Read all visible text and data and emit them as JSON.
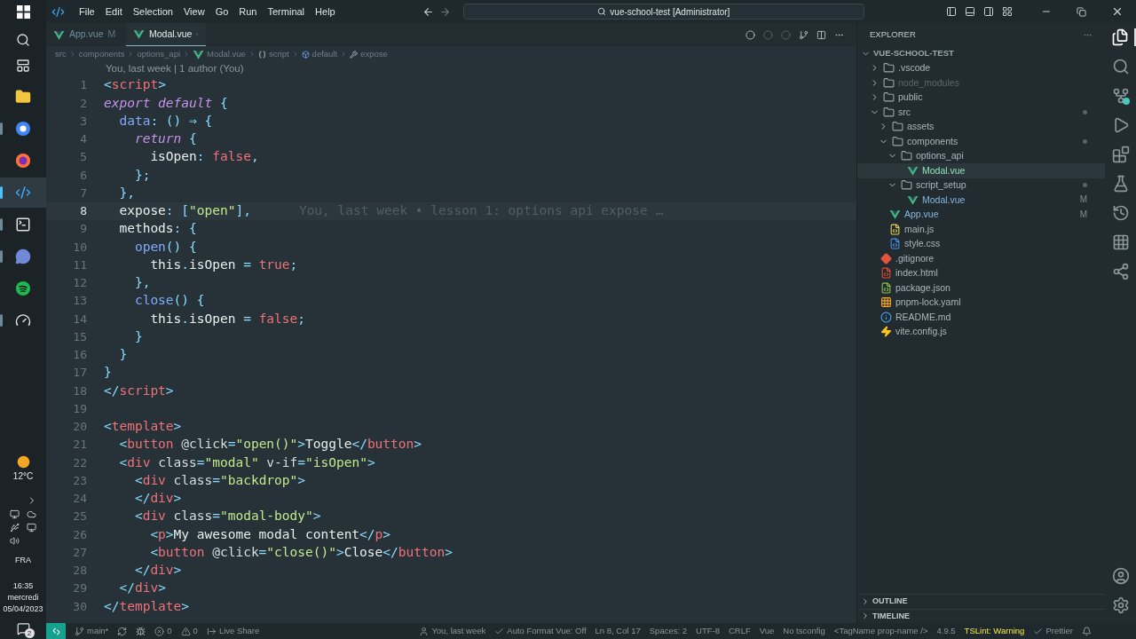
{
  "taskbar": {
    "apps": [
      {
        "kind": "explorer",
        "running": false,
        "selected": false
      },
      {
        "kind": "chrome",
        "running": true,
        "selected": false
      },
      {
        "kind": "firefox",
        "running": false,
        "selected": false
      },
      {
        "kind": "vscode",
        "running": true,
        "selected": true
      },
      {
        "kind": "terminal",
        "running": true,
        "selected": false
      },
      {
        "kind": "discord",
        "running": true,
        "selected": false
      },
      {
        "kind": "spotify",
        "running": false,
        "selected": false
      },
      {
        "kind": "gauge",
        "running": true,
        "selected": false
      }
    ],
    "weather": "12°C",
    "language": "FRA",
    "time": "16:35",
    "day": "mercredi",
    "date": "05/04/2023",
    "notifications": "2"
  },
  "menu": [
    "File",
    "Edit",
    "Selection",
    "View",
    "Go",
    "Run",
    "Terminal",
    "Help"
  ],
  "command_center": "vue-school-test [Administrator]",
  "tabs": [
    {
      "label": "App.vue",
      "badge": "M",
      "selected": false
    },
    {
      "label": "Modal.vue",
      "selected": true
    }
  ],
  "breadcrumbs": [
    {
      "kind": "text",
      "label": "src"
    },
    {
      "kind": "text",
      "label": "components"
    },
    {
      "kind": "text",
      "label": "options_api"
    },
    {
      "kind": "vue",
      "label": "Modal.vue"
    },
    {
      "kind": "braces",
      "label": "script"
    },
    {
      "kind": "module",
      "label": "default"
    },
    {
      "kind": "wrench",
      "label": "expose"
    }
  ],
  "codelens": "You, last week | 1 author (You)",
  "lines": [
    {
      "number": "1",
      "current": false,
      "tokens": [
        {
          "kind": "p",
          "text": "<"
        },
        {
          "kind": "tag",
          "text": "script"
        },
        {
          "kind": "p",
          "text": ">"
        }
      ]
    },
    {
      "number": "2",
      "current": false,
      "tokens": [
        {
          "kind": "kw",
          "text": "export default"
        },
        {
          "kind": "p",
          "text": " {"
        }
      ]
    },
    {
      "number": "3",
      "current": false,
      "tokens": [
        {
          "kind": "prop",
          "text": "  data"
        },
        {
          "kind": "p",
          "text": ": () "
        },
        {
          "kind": "op",
          "text": "⇒"
        },
        {
          "kind": "p",
          "text": " {"
        }
      ]
    },
    {
      "number": "4",
      "current": false,
      "tokens": [
        {
          "kind": "kw",
          "text": "    return"
        },
        {
          "kind": "p",
          "text": " {"
        }
      ]
    },
    {
      "number": "5",
      "current": false,
      "tokens": [
        {
          "kind": "pl",
          "text": "      isOpen"
        },
        {
          "kind": "p",
          "text": ": "
        },
        {
          "kind": "bool",
          "text": "false"
        },
        {
          "kind": "p",
          "text": ","
        }
      ]
    },
    {
      "number": "6",
      "current": false,
      "tokens": [
        {
          "kind": "p",
          "text": "    };"
        }
      ]
    },
    {
      "number": "7",
      "current": false,
      "tokens": [
        {
          "kind": "p",
          "text": "  },"
        }
      ]
    },
    {
      "number": "8",
      "current": true,
      "tokens": [
        {
          "kind": "pl",
          "text": "  expose"
        },
        {
          "kind": "p",
          "text": ": ["
        },
        {
          "kind": "str",
          "text": "\"open\""
        },
        {
          "kind": "p",
          "text": "],"
        }
      ],
      "blame": "You, last week • lesson 1: options api expose …"
    },
    {
      "number": "9",
      "current": false,
      "tokens": [
        {
          "kind": "pl",
          "text": "  methods"
        },
        {
          "kind": "p",
          "text": ": {"
        }
      ]
    },
    {
      "number": "10",
      "current": false,
      "tokens": [
        {
          "kind": "fn",
          "text": "    open"
        },
        {
          "kind": "p",
          "text": "() {"
        }
      ]
    },
    {
      "number": "11",
      "current": false,
      "tokens": [
        {
          "kind": "pl",
          "text": "      this"
        },
        {
          "kind": "p",
          "text": "."
        },
        {
          "kind": "pl",
          "text": "isOpen "
        },
        {
          "kind": "p",
          "text": "= "
        },
        {
          "kind": "bool",
          "text": "true"
        },
        {
          "kind": "p",
          "text": ";"
        }
      ]
    },
    {
      "number": "12",
      "current": false,
      "tokens": [
        {
          "kind": "p",
          "text": "    },"
        }
      ]
    },
    {
      "number": "13",
      "current": false,
      "tokens": [
        {
          "kind": "fn",
          "text": "    close"
        },
        {
          "kind": "p",
          "text": "() {"
        }
      ]
    },
    {
      "number": "14",
      "current": false,
      "tokens": [
        {
          "kind": "pl",
          "text": "      this"
        },
        {
          "kind": "p",
          "text": "."
        },
        {
          "kind": "pl",
          "text": "isOpen "
        },
        {
          "kind": "p",
          "text": "= "
        },
        {
          "kind": "bool",
          "text": "false"
        },
        {
          "kind": "p",
          "text": ";"
        }
      ]
    },
    {
      "number": "15",
      "current": false,
      "tokens": [
        {
          "kind": "p",
          "text": "    }"
        }
      ]
    },
    {
      "number": "16",
      "current": false,
      "tokens": [
        {
          "kind": "p",
          "text": "  }"
        }
      ]
    },
    {
      "number": "17",
      "current": false,
      "tokens": [
        {
          "kind": "p",
          "text": "}"
        }
      ]
    },
    {
      "number": "18",
      "current": false,
      "tokens": [
        {
          "kind": "p",
          "text": "</"
        },
        {
          "kind": "tag",
          "text": "script"
        },
        {
          "kind": "p",
          "text": ">"
        }
      ]
    },
    {
      "number": "19",
      "current": false
    },
    {
      "number": "20",
      "current": false,
      "tokens": [
        {
          "kind": "p",
          "text": "<"
        },
        {
          "kind": "tag",
          "text": "template"
        },
        {
          "kind": "p",
          "text": ">"
        }
      ]
    },
    {
      "number": "21",
      "current": false,
      "tokens": [
        {
          "kind": "p",
          "text": "  <"
        },
        {
          "kind": "tag",
          "text": "button"
        },
        {
          "kind": "attr",
          "text": " @click"
        },
        {
          "kind": "p",
          "text": "="
        },
        {
          "kind": "str",
          "text": "\"open()\""
        },
        {
          "kind": "p",
          "text": ">"
        },
        {
          "kind": "pl",
          "text": "Toggle"
        },
        {
          "kind": "p",
          "text": "</"
        },
        {
          "kind": "tag",
          "text": "button"
        },
        {
          "kind": "p",
          "text": ">"
        }
      ]
    },
    {
      "number": "22",
      "current": false,
      "tokens": [
        {
          "kind": "p",
          "text": "  <"
        },
        {
          "kind": "tag",
          "text": "div"
        },
        {
          "kind": "attr",
          "text": " class"
        },
        {
          "kind": "p",
          "text": "="
        },
        {
          "kind": "str",
          "text": "\"modal\""
        },
        {
          "kind": "attr",
          "text": " v-if"
        },
        {
          "kind": "p",
          "text": "="
        },
        {
          "kind": "str",
          "text": "\"isOpen\""
        },
        {
          "kind": "p",
          "text": ">"
        }
      ]
    },
    {
      "number": "23",
      "current": false,
      "tokens": [
        {
          "kind": "p",
          "text": "    <"
        },
        {
          "kind": "tag",
          "text": "div"
        },
        {
          "kind": "attr",
          "text": " class"
        },
        {
          "kind": "p",
          "text": "="
        },
        {
          "kind": "str",
          "text": "\"backdrop\""
        },
        {
          "kind": "p",
          "text": ">"
        }
      ]
    },
    {
      "number": "24",
      "current": false,
      "tokens": [
        {
          "kind": "p",
          "text": "    </"
        },
        {
          "kind": "tag",
          "text": "div"
        },
        {
          "kind": "p",
          "text": ">"
        }
      ]
    },
    {
      "number": "25",
      "current": false,
      "tokens": [
        {
          "kind": "p",
          "text": "    <"
        },
        {
          "kind": "tag",
          "text": "div"
        },
        {
          "kind": "attr",
          "text": " class"
        },
        {
          "kind": "p",
          "text": "="
        },
        {
          "kind": "str",
          "text": "\"modal-body\""
        },
        {
          "kind": "p",
          "text": ">"
        }
      ]
    },
    {
      "number": "26",
      "current": false,
      "tokens": [
        {
          "kind": "p",
          "text": "      <"
        },
        {
          "kind": "tag",
          "text": "p"
        },
        {
          "kind": "p",
          "text": ">"
        },
        {
          "kind": "pl",
          "text": "My awesome modal content"
        },
        {
          "kind": "p",
          "text": "</"
        },
        {
          "kind": "tag",
          "text": "p"
        },
        {
          "kind": "p",
          "text": ">"
        }
      ]
    },
    {
      "number": "27",
      "current": false,
      "tokens": [
        {
          "kind": "p",
          "text": "      <"
        },
        {
          "kind": "tag",
          "text": "button"
        },
        {
          "kind": "attr",
          "text": " @click"
        },
        {
          "kind": "p",
          "text": "="
        },
        {
          "kind": "str",
          "text": "\"close()\""
        },
        {
          "kind": "p",
          "text": ">"
        },
        {
          "kind": "pl",
          "text": "Close"
        },
        {
          "kind": "p",
          "text": "</"
        },
        {
          "kind": "tag",
          "text": "button"
        },
        {
          "kind": "p",
          "text": ">"
        }
      ]
    },
    {
      "number": "28",
      "current": false,
      "tokens": [
        {
          "kind": "p",
          "text": "    </"
        },
        {
          "kind": "tag",
          "text": "div"
        },
        {
          "kind": "p",
          "text": ">"
        }
      ]
    },
    {
      "number": "29",
      "current": false,
      "tokens": [
        {
          "kind": "p",
          "text": "  </"
        },
        {
          "kind": "tag",
          "text": "div"
        },
        {
          "kind": "p",
          "text": ">"
        }
      ]
    },
    {
      "number": "30",
      "current": false,
      "tokens": [
        {
          "kind": "p",
          "text": "</"
        },
        {
          "kind": "tag",
          "text": "template"
        },
        {
          "kind": "p",
          "text": ">"
        }
      ]
    }
  ],
  "explorer": {
    "title": "EXPLORER",
    "root": "VUE-SCHOOL-TEST",
    "items": [
      {
        "name": ".vscode",
        "kind": "folder",
        "expanded": false,
        "ignored": false,
        "selected": false,
        "dot": false
      },
      {
        "name": "node_modules",
        "kind": "folder",
        "expanded": false,
        "ignored": true,
        "selected": false,
        "dot": false
      },
      {
        "name": "public",
        "kind": "folder",
        "expanded": false,
        "ignored": false,
        "selected": false,
        "dot": false
      },
      {
        "name": "src",
        "kind": "folder",
        "expanded": true,
        "ignored": false,
        "selected": false,
        "dot": true,
        "children": [
          {
            "name": "assets",
            "kind": "folder",
            "expanded": false,
            "ignored": false,
            "selected": false,
            "dot": false
          },
          {
            "name": "components",
            "kind": "folder",
            "expanded": true,
            "ignored": false,
            "selected": false,
            "dot": true,
            "children": [
              {
                "name": "options_api",
                "kind": "folder",
                "expanded": true,
                "ignored": false,
                "selected": false,
                "dot": false,
                "children": [
                  {
                    "name": "Modal.vue",
                    "kind": "vue",
                    "ignored": false,
                    "selected": true,
                    "dot": false
                  }
                ]
              },
              {
                "name": "script_setup",
                "kind": "folder",
                "expanded": true,
                "ignored": false,
                "selected": false,
                "dot": true,
                "children": [
                  {
                    "name": "Modal.vue",
                    "kind": "vue",
                    "ignored": false,
                    "selected": false,
                    "dot": false,
                    "badge": "M"
                  }
                ]
              }
            ]
          },
          {
            "name": "App.vue",
            "kind": "vue",
            "ignored": false,
            "selected": false,
            "dot": false,
            "badge": "M"
          },
          {
            "name": "main.js",
            "kind": "js",
            "ignored": false,
            "selected": false,
            "dot": false
          },
          {
            "name": "style.css",
            "kind": "css",
            "ignored": false,
            "selected": false,
            "dot": false
          }
        ]
      },
      {
        "name": ".gitignore",
        "kind": "git",
        "ignored": false,
        "selected": false,
        "dot": false
      },
      {
        "name": "index.html",
        "kind": "html",
        "ignored": false,
        "selected": false,
        "dot": false
      },
      {
        "name": "package.json",
        "kind": "json",
        "ignored": false,
        "selected": false,
        "dot": false
      },
      {
        "name": "pnpm-lock.yaml",
        "kind": "yaml",
        "ignored": false,
        "selected": false,
        "dot": false
      },
      {
        "name": "README.md",
        "kind": "info",
        "ignored": false,
        "selected": false,
        "dot": false
      },
      {
        "name": "vite.config.js",
        "kind": "vite",
        "ignored": false,
        "selected": false,
        "dot": false
      }
    ],
    "sections": [
      {
        "label": "OUTLINE",
        "expanded": false
      },
      {
        "label": "TIMELINE",
        "expanded": false
      }
    ]
  },
  "activity_bar": [
    {
      "kind": "files",
      "selected": true
    },
    {
      "kind": "search",
      "selected": false
    },
    {
      "kind": "scm",
      "selected": false
    },
    {
      "kind": "debug",
      "selected": false
    },
    {
      "kind": "extensions",
      "selected": false
    },
    {
      "kind": "testing",
      "selected": false
    },
    {
      "kind": "graph",
      "selected": false
    },
    {
      "kind": "n2",
      "selected": false
    },
    {
      "kind": "share",
      "selected": false
    }
  ],
  "status_bar": {
    "left": [
      {
        "kind": "branch",
        "text": "main*"
      },
      {
        "kind": "sync"
      },
      {
        "kind": "debug"
      },
      {
        "kind": "error",
        "text": "0"
      },
      {
        "kind": "warning",
        "text": "0"
      },
      {
        "kind": "share",
        "text": "Live Share"
      }
    ],
    "right": [
      {
        "kind": "person",
        "text": "You, last week"
      },
      {
        "kind": "check",
        "text": "Auto Format Vue: Off"
      },
      {
        "kind": "plain",
        "text": "Ln 8, Col 17"
      },
      {
        "kind": "plain",
        "text": "Spaces: 2"
      },
      {
        "kind": "plain",
        "text": "UTF-8"
      },
      {
        "kind": "plain",
        "text": "CRLF"
      },
      {
        "kind": "plain",
        "text": "Vue"
      },
      {
        "kind": "plain",
        "text": "No tsconfig"
      },
      {
        "kind": "plain",
        "text": "<TagName prop-name />"
      },
      {
        "kind": "plain",
        "text": "4.9.5"
      },
      {
        "kind": "plain",
        "text": "TSLint: Warning",
        "warning": true
      },
      {
        "kind": "check",
        "text": "Prettier"
      },
      {
        "kind": "bell"
      }
    ]
  }
}
